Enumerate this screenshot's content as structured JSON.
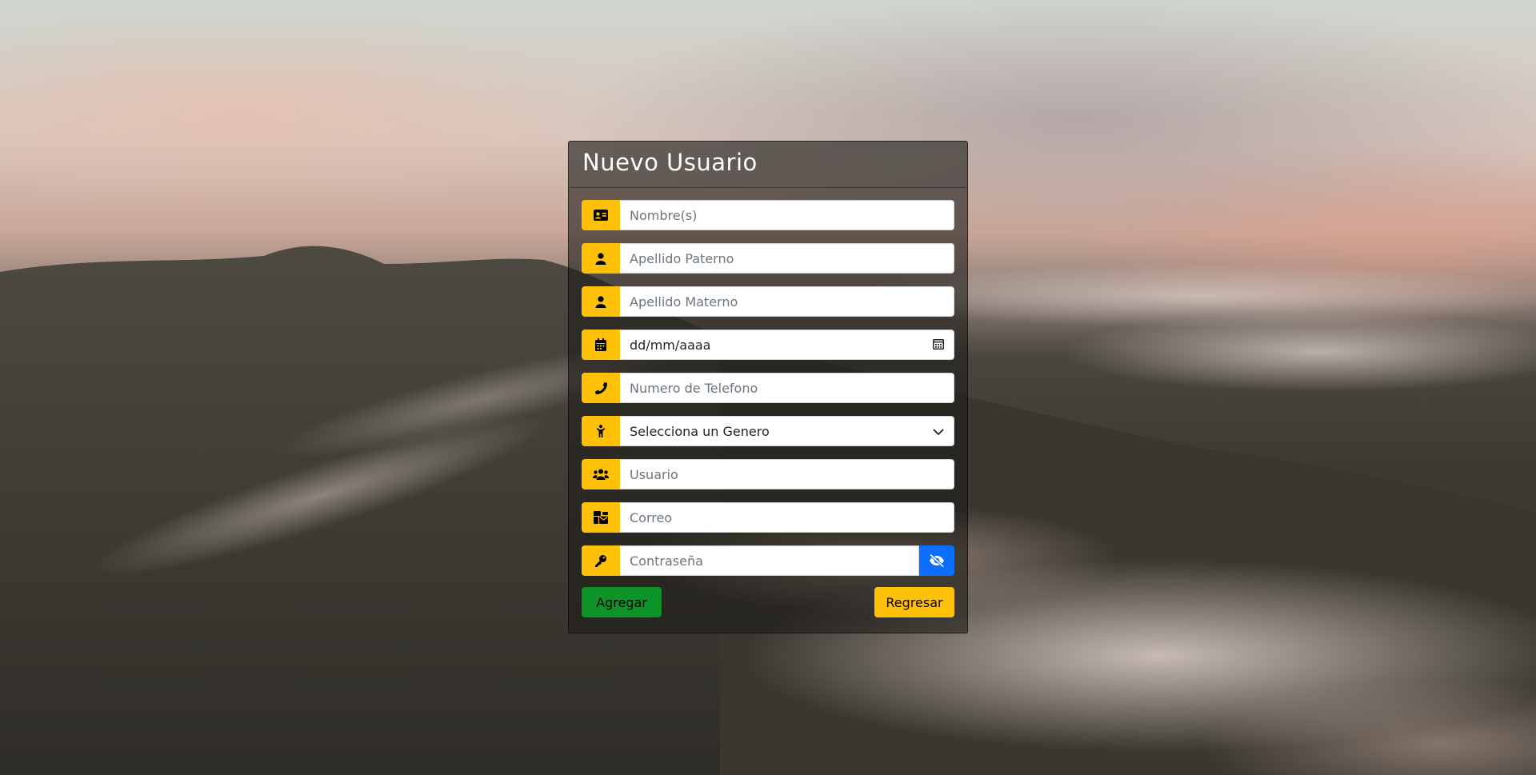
{
  "form": {
    "title": "Nuevo Usuario",
    "fields": [
      {
        "icon": "id-card-icon",
        "placeholder": "Nombre(s)"
      },
      {
        "icon": "user-icon",
        "placeholder": "Apellido Paterno"
      },
      {
        "icon": "user-icon",
        "placeholder": "Apellido Materno"
      },
      {
        "icon": "calendar-icon",
        "value": "dd/mm/aaaa"
      },
      {
        "icon": "phone-icon",
        "placeholder": "Numero de Telefono"
      },
      {
        "icon": "person-icon",
        "value": "Selecciona un Genero"
      },
      {
        "icon": "users-icon",
        "placeholder": "Usuario"
      },
      {
        "icon": "mail-bulk-icon",
        "placeholder": "Correo"
      },
      {
        "icon": "key-icon",
        "placeholder": "Contraseña"
      }
    ],
    "add_label": "Agregar",
    "back_label": "Regresar"
  },
  "colors": {
    "addon": "#ffc107",
    "add_button": "#0d9429",
    "back_button": "#ffc107",
    "toggle_button": "#0d6efd"
  }
}
